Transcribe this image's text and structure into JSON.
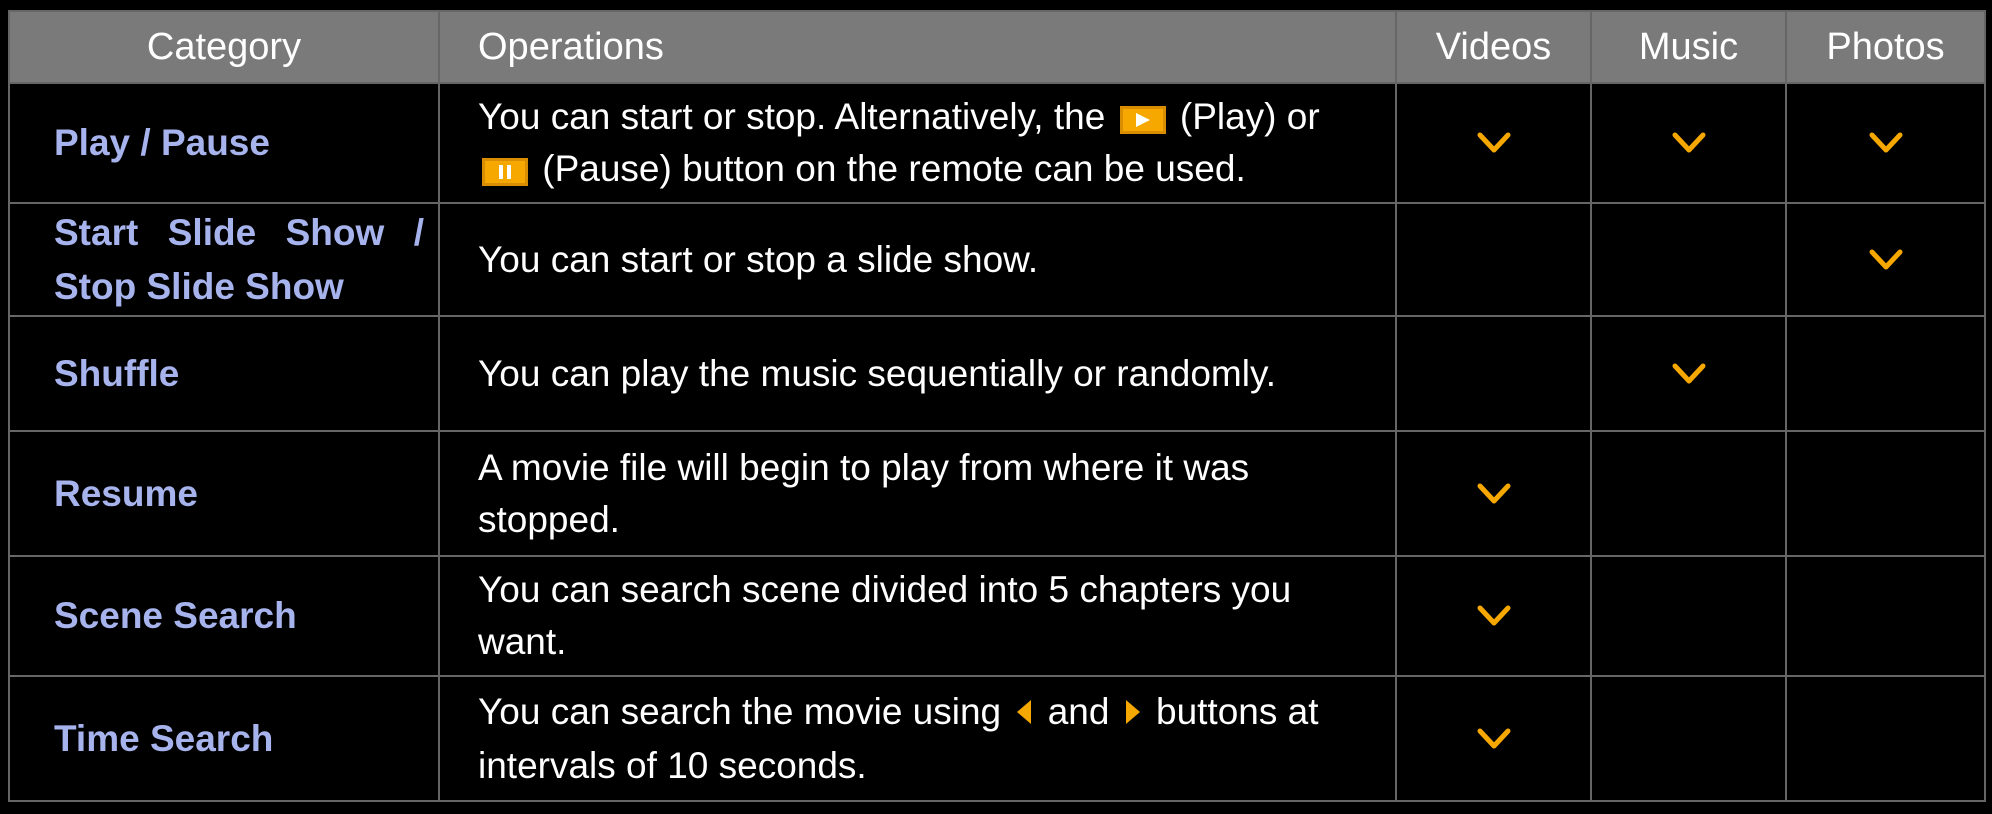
{
  "headers": {
    "category": "Category",
    "operations": "Operations",
    "videos": "Videos",
    "music": "Music",
    "photos": "Photos"
  },
  "accent_color": "#f6a800",
  "category_color": "#a7b3ec",
  "rows": [
    {
      "category": "Play / Pause",
      "op_a": "You can start or stop. Alternatively, the",
      "op_b": "(Play) or",
      "op_c": "(Pause) button on the remote can be used.",
      "icons": [
        "play-key-icon",
        "pause-key-icon"
      ],
      "videos": true,
      "music": true,
      "photos": true
    },
    {
      "category": "Start Slide Show / Stop Slide Show",
      "op": "You can start or stop a slide show.",
      "videos": false,
      "music": false,
      "photos": true
    },
    {
      "category": "Shuffle",
      "op": "You can play the music sequentially or randomly.",
      "videos": false,
      "music": true,
      "photos": false
    },
    {
      "category": "Resume",
      "op": "A movie file will begin to play from where it was stopped.",
      "videos": true,
      "music": false,
      "photos": false
    },
    {
      "category": "Scene Search",
      "op": "You can search scene divided into 5 chapters you want.",
      "videos": true,
      "music": false,
      "photos": false
    },
    {
      "category": "Time Search",
      "op_a": "You can search the movie using",
      "op_b": "and",
      "op_c": "buttons at intervals of 10 seconds.",
      "icons": [
        "left-arrow-icon",
        "right-arrow-icon"
      ],
      "videos": true,
      "music": false,
      "photos": false
    }
  ]
}
